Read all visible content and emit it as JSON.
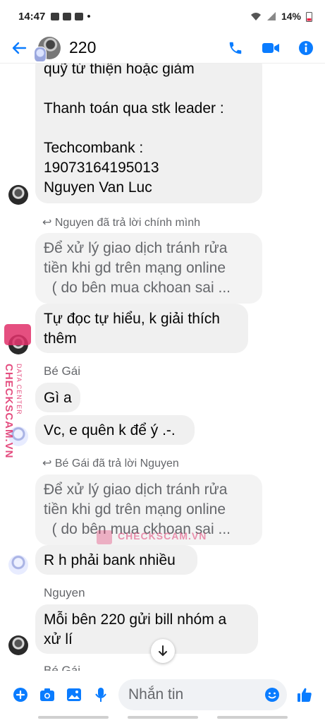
{
  "status": {
    "time": "14:47",
    "battery": "14%"
  },
  "header": {
    "title": "220"
  },
  "messages": {
    "m1": "quỹ từ thiện hoặc giảm\n\nThanh toán qua stk leader :\n\nTechcombank :\n19073164195013\nNguyen Van Luc",
    "reply1_note": "Nguyen đã trả lời chính mình",
    "quote1": "Để xử lý giao dịch tránh rửa\ntiền khi gd trên mạng online\n  ( do bên mua ckhoan sai ...",
    "m2": "Tự đọc tự hiểu, k giải thích\nthêm",
    "sender1": "Bé Gái",
    "m3": "Gì a",
    "m4": "Vc, e quên k để ý .-.",
    "reply2_note": "Bé Gái đã trả lời Nguyen",
    "quote2": "Để xử lý giao dịch tránh rửa\ntiền khi gd trên mạng online\n  ( do bên mua ckhoan sai ...",
    "m5": "R h phải bank nhiều",
    "sender2": "Nguyen",
    "m6": "Mỗi bên 220 gửi bill nhóm a\nxử lí",
    "sender3": "Bé Gái"
  },
  "watermark": {
    "brand": "CHECKSCAM.VN",
    "sub": "DATA CENTER"
  },
  "composer": {
    "placeholder": "Nhắn tin"
  },
  "icons": {
    "back": "arrow-left-icon",
    "call": "phone-icon",
    "video": "video-camera-icon",
    "info": "info-icon",
    "add": "plus-icon",
    "camera": "camera-icon",
    "gallery": "image-icon",
    "mic": "microphone-icon",
    "emoji": "emoji-icon",
    "like": "thumbs-up-icon",
    "scroll": "arrow-down-icon"
  },
  "colors": {
    "accent": "#0a7cff",
    "bubble": "#f0f0f0",
    "watermark": "#e0306a"
  }
}
